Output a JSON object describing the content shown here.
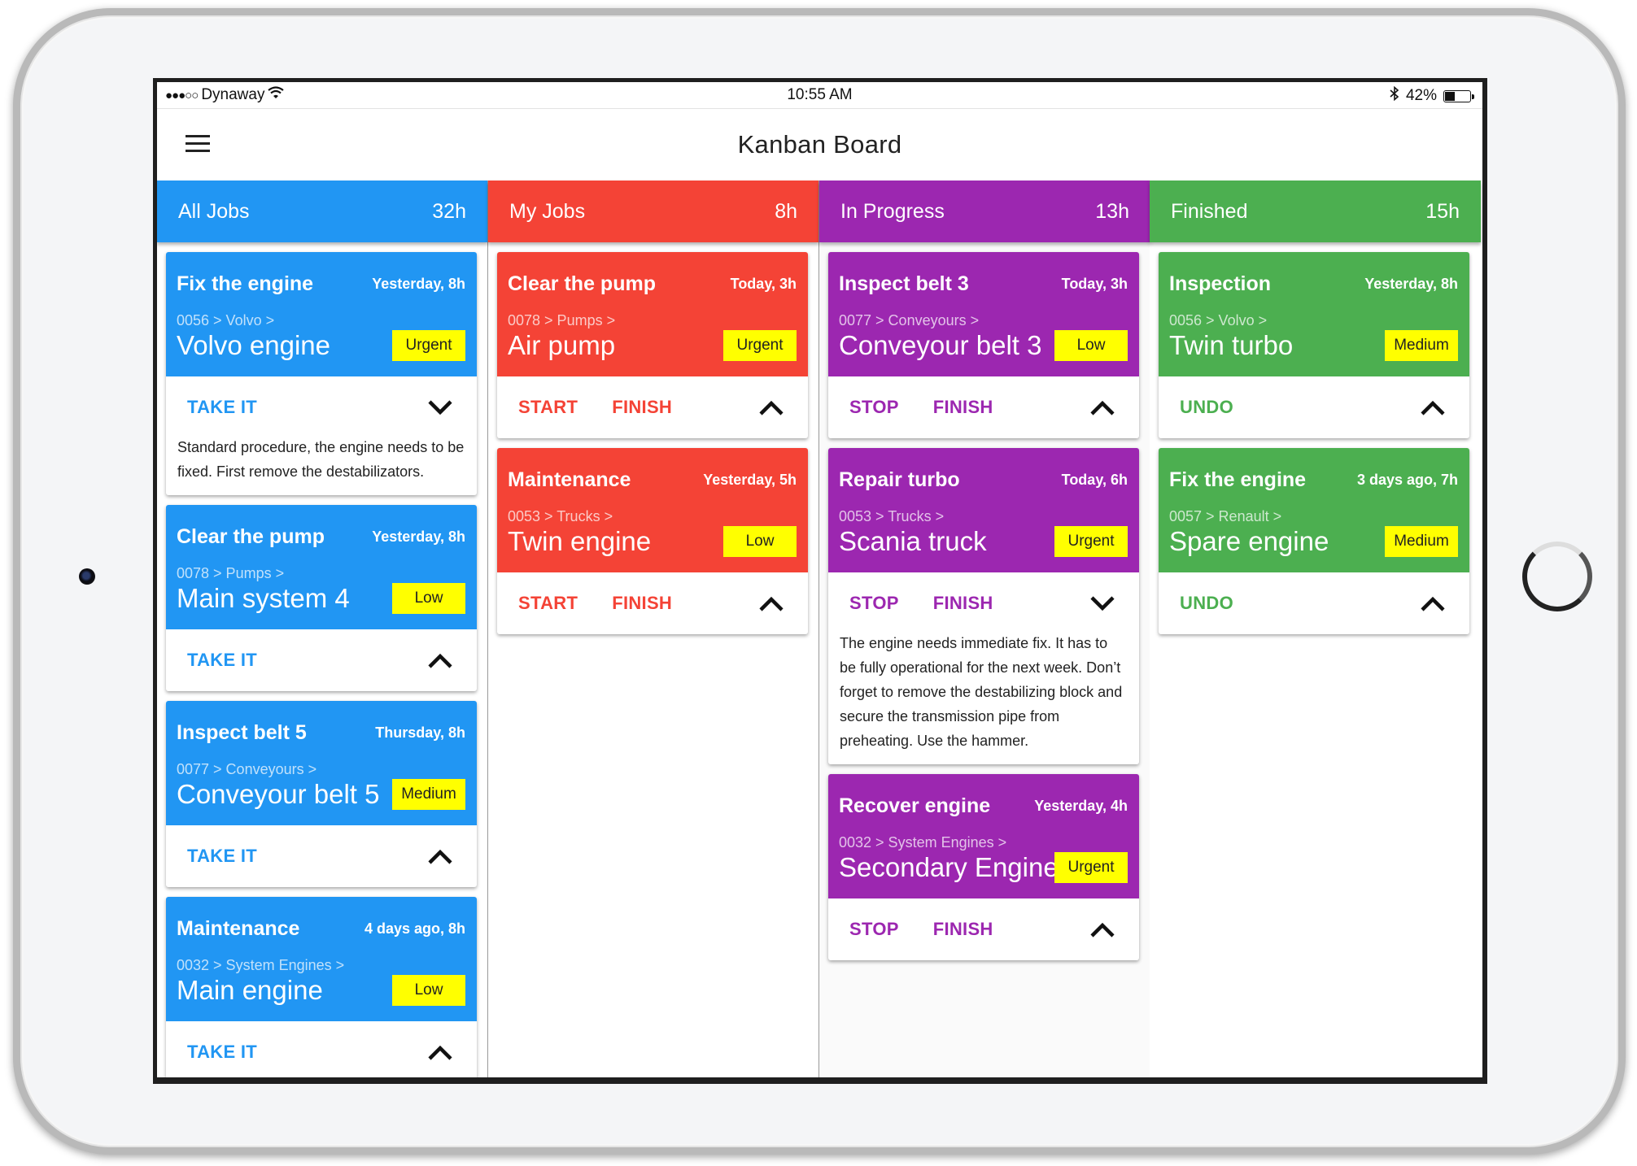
{
  "status_bar": {
    "signal": "●●●○○",
    "carrier": "Dynaway",
    "time": "10:55 AM",
    "battery_percent_label": "42%",
    "battery_level": 0.42
  },
  "navbar": {
    "title": "Kanban Board",
    "menu_icon": "hamburger-icon"
  },
  "colors": {
    "all_jobs": "#2196F3",
    "my_jobs": "#F44336",
    "in_progress": "#9C27B0",
    "finished": "#4CAF50",
    "priority_badge": "#FFFF00"
  },
  "columns": [
    {
      "name": "All Jobs",
      "hours": "32h",
      "color": "#2196F3",
      "cards": [
        {
          "title": "Fix the engine",
          "when": "Yesterday, 8h",
          "path": "0056 > Volvo >",
          "asset": "Volvo engine",
          "priority": "Urgent",
          "actions": [
            "TAKE IT"
          ],
          "expanded": true,
          "description": "Standard procedure, the engine needs to be fixed. First remove the destabilizators."
        },
        {
          "title": "Clear the pump",
          "when": "Yesterday, 8h",
          "path": "0078 > Pumps >",
          "asset": "Main system 4",
          "priority": "Low",
          "actions": [
            "TAKE IT"
          ],
          "expanded": false
        },
        {
          "title": "Inspect belt 5",
          "when": "Thursday, 8h",
          "path": "0077 > Conveyours >",
          "asset": "Conveyour belt 5",
          "priority": "Medium",
          "actions": [
            "TAKE IT"
          ],
          "expanded": false
        },
        {
          "title": "Maintenance",
          "when": "4 days ago, 8h",
          "path": "0032 > System Engines >",
          "asset": "Main engine",
          "priority": "Low",
          "actions": [
            "TAKE IT"
          ],
          "expanded": false
        }
      ]
    },
    {
      "name": "My Jobs",
      "hours": "8h",
      "color": "#F44336",
      "cards": [
        {
          "title": "Clear the pump",
          "when": "Today, 3h",
          "path": "0078 > Pumps >",
          "asset": "Air pump",
          "priority": "Urgent",
          "actions": [
            "START",
            "FINISH"
          ],
          "expanded": false
        },
        {
          "title": "Maintenance",
          "when": "Yesterday, 5h",
          "path": "0053 > Trucks >",
          "asset": "Twin engine",
          "priority": "Low",
          "actions": [
            "START",
            "FINISH"
          ],
          "expanded": false
        }
      ]
    },
    {
      "name": "In Progress",
      "hours": "13h",
      "color": "#9C27B0",
      "cards": [
        {
          "title": "Inspect belt 3",
          "when": "Today, 3h",
          "path": "0077 > Conveyours >",
          "asset": "Conveyour belt 3",
          "priority": "Low",
          "actions": [
            "STOP",
            "FINISH"
          ],
          "expanded": false
        },
        {
          "title": "Repair turbo",
          "when": "Today, 6h",
          "path": "0053 > Trucks >",
          "asset": "Scania truck",
          "priority": "Urgent",
          "actions": [
            "STOP",
            "FINISH"
          ],
          "expanded": true,
          "description": "The engine needs immediate fix. It has to be fully operational for the next week. Don’t forget to remove the destabilizing block and secure the transmission pipe from preheating. Use the hammer."
        },
        {
          "title": "Recover engine",
          "when": "Yesterday, 4h",
          "path": "0032 > System Engines >",
          "asset": "Secondary Engine",
          "priority": "Urgent",
          "actions": [
            "STOP",
            "FINISH"
          ],
          "expanded": false
        }
      ]
    },
    {
      "name": "Finished",
      "hours": "15h",
      "color": "#4CAF50",
      "cards": [
        {
          "title": "Inspection",
          "when": "Yesterday, 8h",
          "path": "0056 > Volvo >",
          "asset": "Twin turbo",
          "priority": "Medium",
          "actions": [
            "UNDO"
          ],
          "expanded": false
        },
        {
          "title": "Fix the engine",
          "when": "3 days ago, 7h",
          "path": "0057 > Renault >",
          "asset": "Spare engine",
          "priority": "Medium",
          "actions": [
            "UNDO"
          ],
          "expanded": false
        }
      ]
    }
  ]
}
